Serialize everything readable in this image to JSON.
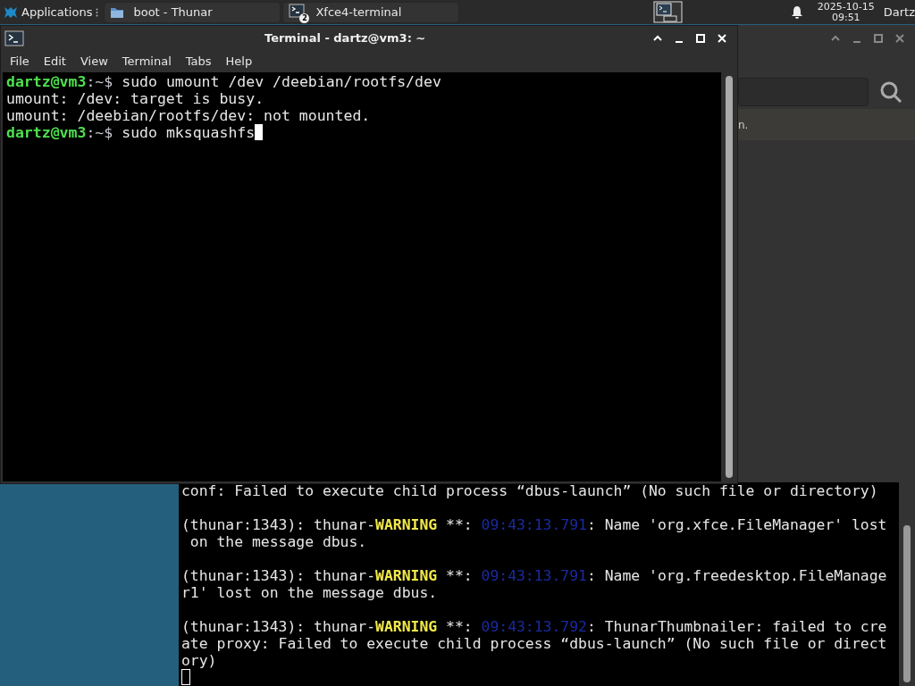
{
  "taskbar": {
    "apps_label": "Applications",
    "tasks": [
      {
        "label": "boot - Thunar",
        "kind": "folder"
      },
      {
        "label": "Xfce4-terminal",
        "kind": "terminal",
        "badge": "2"
      }
    ],
    "clock": {
      "date": "2025-10-15",
      "time": "09:51"
    },
    "user": "Dartz"
  },
  "terminal": {
    "title": "Terminal - dartz@vm3: ~",
    "menu": [
      "File",
      "Edit",
      "View",
      "Terminal",
      "Tabs",
      "Help"
    ],
    "lines": [
      {
        "kind": "prompt",
        "user": "dartz@vm3",
        "rest": ":~$",
        "command": "sudo umount /dev /deebian/rootfs/dev"
      },
      {
        "kind": "output",
        "text": "umount: /dev: target is busy."
      },
      {
        "kind": "output",
        "text": "umount: /deebian/rootfs/dev: not mounted."
      },
      {
        "kind": "prompt",
        "user": "dartz@vm3",
        "rest": ":~$",
        "command": "sudo mksquashfs",
        "cursor": true
      }
    ]
  },
  "file_manager": {
    "status_text": "n."
  },
  "log_terminal": {
    "lines": [
      {
        "kind": "text",
        "segments": [
          {
            "kind": "plain",
            "text": "conf: Failed to execute child process “dbus-launch” (No such file or directory)"
          }
        ]
      },
      {
        "kind": "blank"
      },
      {
        "kind": "text",
        "segments": [
          {
            "kind": "plain",
            "text": "(thunar:1343): thunar-"
          },
          {
            "kind": "warning",
            "text": "WARNING"
          },
          {
            "kind": "plain",
            "text": " **: "
          },
          {
            "kind": "timestamp",
            "text": "09:43:13.791"
          },
          {
            "kind": "plain",
            "text": ": Name 'org.xfce.FileManager' lost"
          }
        ]
      },
      {
        "kind": "text",
        "segments": [
          {
            "kind": "plain",
            "text": " on the message dbus."
          }
        ]
      },
      {
        "kind": "blank"
      },
      {
        "kind": "text",
        "segments": [
          {
            "kind": "plain",
            "text": "(thunar:1343): thunar-"
          },
          {
            "kind": "warning",
            "text": "WARNING"
          },
          {
            "kind": "plain",
            "text": " **: "
          },
          {
            "kind": "timestamp",
            "text": "09:43:13.791"
          },
          {
            "kind": "plain",
            "text": ": Name 'org.freedesktop.FileManage"
          }
        ]
      },
      {
        "kind": "text",
        "segments": [
          {
            "kind": "plain",
            "text": "r1' lost on the message dbus."
          }
        ]
      },
      {
        "kind": "blank"
      },
      {
        "kind": "text",
        "segments": [
          {
            "kind": "plain",
            "text": "(thunar:1343): thunar-"
          },
          {
            "kind": "warning",
            "text": "WARNING"
          },
          {
            "kind": "plain",
            "text": " **: "
          },
          {
            "kind": "timestamp",
            "text": "09:43:13.792"
          },
          {
            "kind": "plain",
            "text": ": ThunarThumbnailer: failed to cre"
          }
        ]
      },
      {
        "kind": "text",
        "segments": [
          {
            "kind": "plain",
            "text": "ate proxy: Failed to execute child process “dbus-launch” (No such file or direct"
          }
        ]
      },
      {
        "kind": "text",
        "segments": [
          {
            "kind": "plain",
            "text": "ory)"
          }
        ]
      },
      {
        "kind": "cursor"
      }
    ]
  }
}
